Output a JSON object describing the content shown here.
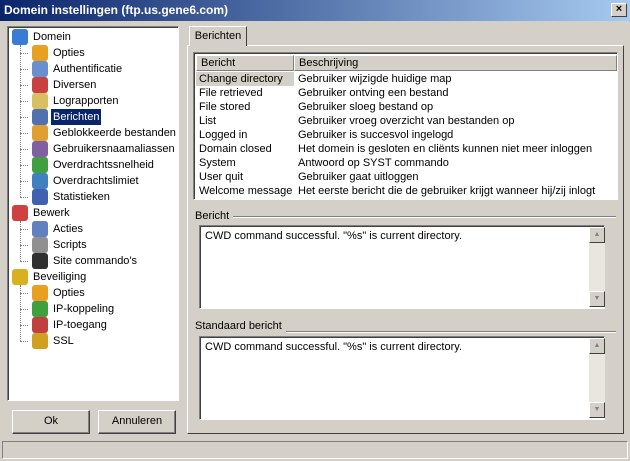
{
  "window": {
    "title": "Domein instellingen (ftp.us.gene6.com)",
    "close_glyph": "×"
  },
  "tree": {
    "groups": [
      {
        "label": "Domein",
        "icon": "globe-icon",
        "color": "#3a7bd5",
        "items": [
          {
            "label": "Opties",
            "icon": "options-icon",
            "color": "#e8a020"
          },
          {
            "label": "Authentificatie",
            "icon": "authentication-icon",
            "color": "#6a8fd0"
          },
          {
            "label": "Diversen",
            "icon": "misc-icon",
            "color": "#c84040"
          },
          {
            "label": "Lograpporten",
            "icon": "log-icon",
            "color": "#d8c060"
          },
          {
            "label": "Berichten",
            "icon": "messages-icon",
            "color": "#5070b0",
            "selected": true
          },
          {
            "label": "Geblokkeerde bestanden",
            "icon": "blocked-files-icon",
            "color": "#e0a030"
          },
          {
            "label": "Gebruikersnaamaliassen",
            "icon": "user-alias-icon",
            "color": "#8060a0"
          },
          {
            "label": "Overdrachtssnelheid",
            "icon": "speed-icon",
            "color": "#40a040"
          },
          {
            "label": "Overdrachtslimiet",
            "icon": "limit-icon",
            "color": "#4080c0"
          },
          {
            "label": "Statistieken",
            "icon": "stats-icon",
            "color": "#4060b0"
          }
        ]
      },
      {
        "label": "Bewerk",
        "icon": "edit-icon",
        "color": "#d04040",
        "items": [
          {
            "label": "Acties",
            "icon": "actions-icon",
            "color": "#6080c0"
          },
          {
            "label": "Scripts",
            "icon": "scripts-icon",
            "color": "#909090"
          },
          {
            "label": "Site commando's",
            "icon": "console-icon",
            "color": "#303030"
          }
        ]
      },
      {
        "label": "Beveiliging",
        "icon": "security-icon",
        "color": "#d8b020",
        "items": [
          {
            "label": "Opties",
            "icon": "options-icon",
            "color": "#e8a020"
          },
          {
            "label": "IP-koppeling",
            "icon": "ip-binding-icon",
            "color": "#40a040"
          },
          {
            "label": "IP-toegang",
            "icon": "ip-access-icon",
            "color": "#c04040"
          },
          {
            "label": "SSL",
            "icon": "key-icon",
            "color": "#d0a020"
          }
        ]
      }
    ]
  },
  "buttons": {
    "ok": "Ok",
    "cancel": "Annuleren"
  },
  "tab": {
    "label": "Berichten"
  },
  "list": {
    "columns": [
      "Bericht",
      "Beschrijving"
    ],
    "rows": [
      {
        "name": "Change directory",
        "desc": "Gebruiker wijzigde huidige map",
        "selected": true
      },
      {
        "name": "File retrieved",
        "desc": "Gebruiker ontving een bestand"
      },
      {
        "name": "File stored",
        "desc": "Gebruiker sloeg bestand op"
      },
      {
        "name": "List",
        "desc": "Gebruiker vroeg overzicht van bestanden op"
      },
      {
        "name": "Logged in",
        "desc": "Gebruiker is succesvol ingelogd"
      },
      {
        "name": "Domain closed",
        "desc": "Het domein is gesloten en cliënts kunnen niet meer inloggen"
      },
      {
        "name": "System",
        "desc": "Antwoord op SYST commando"
      },
      {
        "name": "User quit",
        "desc": "Gebruiker gaat uitloggen"
      },
      {
        "name": "Welcome message",
        "desc": "Het eerste bericht die de gebruiker krijgt wanneer hij/zij inlogt"
      }
    ]
  },
  "message": {
    "label": "Bericht",
    "text": "CWD command successful. \"%s\" is current directory."
  },
  "default_message": {
    "label": "Standaard bericht",
    "text": "CWD command successful. \"%s\" is current directory."
  },
  "scroll_glyphs": {
    "up": "▲",
    "down": "▼"
  }
}
